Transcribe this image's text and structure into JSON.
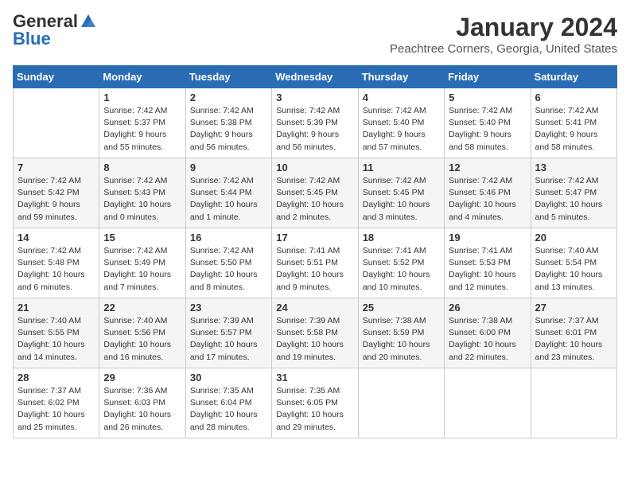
{
  "header": {
    "logo_general": "General",
    "logo_blue": "Blue",
    "month_title": "January 2024",
    "location": "Peachtree Corners, Georgia, United States"
  },
  "days_of_week": [
    "Sunday",
    "Monday",
    "Tuesday",
    "Wednesday",
    "Thursday",
    "Friday",
    "Saturday"
  ],
  "weeks": [
    [
      {
        "day": "",
        "info": ""
      },
      {
        "day": "1",
        "info": "Sunrise: 7:42 AM\nSunset: 5:37 PM\nDaylight: 9 hours\nand 55 minutes."
      },
      {
        "day": "2",
        "info": "Sunrise: 7:42 AM\nSunset: 5:38 PM\nDaylight: 9 hours\nand 56 minutes."
      },
      {
        "day": "3",
        "info": "Sunrise: 7:42 AM\nSunset: 5:39 PM\nDaylight: 9 hours\nand 56 minutes."
      },
      {
        "day": "4",
        "info": "Sunrise: 7:42 AM\nSunset: 5:40 PM\nDaylight: 9 hours\nand 57 minutes."
      },
      {
        "day": "5",
        "info": "Sunrise: 7:42 AM\nSunset: 5:40 PM\nDaylight: 9 hours\nand 58 minutes."
      },
      {
        "day": "6",
        "info": "Sunrise: 7:42 AM\nSunset: 5:41 PM\nDaylight: 9 hours\nand 58 minutes."
      }
    ],
    [
      {
        "day": "7",
        "info": "Sunrise: 7:42 AM\nSunset: 5:42 PM\nDaylight: 9 hours\nand 59 minutes."
      },
      {
        "day": "8",
        "info": "Sunrise: 7:42 AM\nSunset: 5:43 PM\nDaylight: 10 hours\nand 0 minutes."
      },
      {
        "day": "9",
        "info": "Sunrise: 7:42 AM\nSunset: 5:44 PM\nDaylight: 10 hours\nand 1 minute."
      },
      {
        "day": "10",
        "info": "Sunrise: 7:42 AM\nSunset: 5:45 PM\nDaylight: 10 hours\nand 2 minutes."
      },
      {
        "day": "11",
        "info": "Sunrise: 7:42 AM\nSunset: 5:45 PM\nDaylight: 10 hours\nand 3 minutes."
      },
      {
        "day": "12",
        "info": "Sunrise: 7:42 AM\nSunset: 5:46 PM\nDaylight: 10 hours\nand 4 minutes."
      },
      {
        "day": "13",
        "info": "Sunrise: 7:42 AM\nSunset: 5:47 PM\nDaylight: 10 hours\nand 5 minutes."
      }
    ],
    [
      {
        "day": "14",
        "info": "Sunrise: 7:42 AM\nSunset: 5:48 PM\nDaylight: 10 hours\nand 6 minutes."
      },
      {
        "day": "15",
        "info": "Sunrise: 7:42 AM\nSunset: 5:49 PM\nDaylight: 10 hours\nand 7 minutes."
      },
      {
        "day": "16",
        "info": "Sunrise: 7:42 AM\nSunset: 5:50 PM\nDaylight: 10 hours\nand 8 minutes."
      },
      {
        "day": "17",
        "info": "Sunrise: 7:41 AM\nSunset: 5:51 PM\nDaylight: 10 hours\nand 9 minutes."
      },
      {
        "day": "18",
        "info": "Sunrise: 7:41 AM\nSunset: 5:52 PM\nDaylight: 10 hours\nand 10 minutes."
      },
      {
        "day": "19",
        "info": "Sunrise: 7:41 AM\nSunset: 5:53 PM\nDaylight: 10 hours\nand 12 minutes."
      },
      {
        "day": "20",
        "info": "Sunrise: 7:40 AM\nSunset: 5:54 PM\nDaylight: 10 hours\nand 13 minutes."
      }
    ],
    [
      {
        "day": "21",
        "info": "Sunrise: 7:40 AM\nSunset: 5:55 PM\nDaylight: 10 hours\nand 14 minutes."
      },
      {
        "day": "22",
        "info": "Sunrise: 7:40 AM\nSunset: 5:56 PM\nDaylight: 10 hours\nand 16 minutes."
      },
      {
        "day": "23",
        "info": "Sunrise: 7:39 AM\nSunset: 5:57 PM\nDaylight: 10 hours\nand 17 minutes."
      },
      {
        "day": "24",
        "info": "Sunrise: 7:39 AM\nSunset: 5:58 PM\nDaylight: 10 hours\nand 19 minutes."
      },
      {
        "day": "25",
        "info": "Sunrise: 7:38 AM\nSunset: 5:59 PM\nDaylight: 10 hours\nand 20 minutes."
      },
      {
        "day": "26",
        "info": "Sunrise: 7:38 AM\nSunset: 6:00 PM\nDaylight: 10 hours\nand 22 minutes."
      },
      {
        "day": "27",
        "info": "Sunrise: 7:37 AM\nSunset: 6:01 PM\nDaylight: 10 hours\nand 23 minutes."
      }
    ],
    [
      {
        "day": "28",
        "info": "Sunrise: 7:37 AM\nSunset: 6:02 PM\nDaylight: 10 hours\nand 25 minutes."
      },
      {
        "day": "29",
        "info": "Sunrise: 7:36 AM\nSunset: 6:03 PM\nDaylight: 10 hours\nand 26 minutes."
      },
      {
        "day": "30",
        "info": "Sunrise: 7:35 AM\nSunset: 6:04 PM\nDaylight: 10 hours\nand 28 minutes."
      },
      {
        "day": "31",
        "info": "Sunrise: 7:35 AM\nSunset: 6:05 PM\nDaylight: 10 hours\nand 29 minutes."
      },
      {
        "day": "",
        "info": ""
      },
      {
        "day": "",
        "info": ""
      },
      {
        "day": "",
        "info": ""
      }
    ]
  ]
}
